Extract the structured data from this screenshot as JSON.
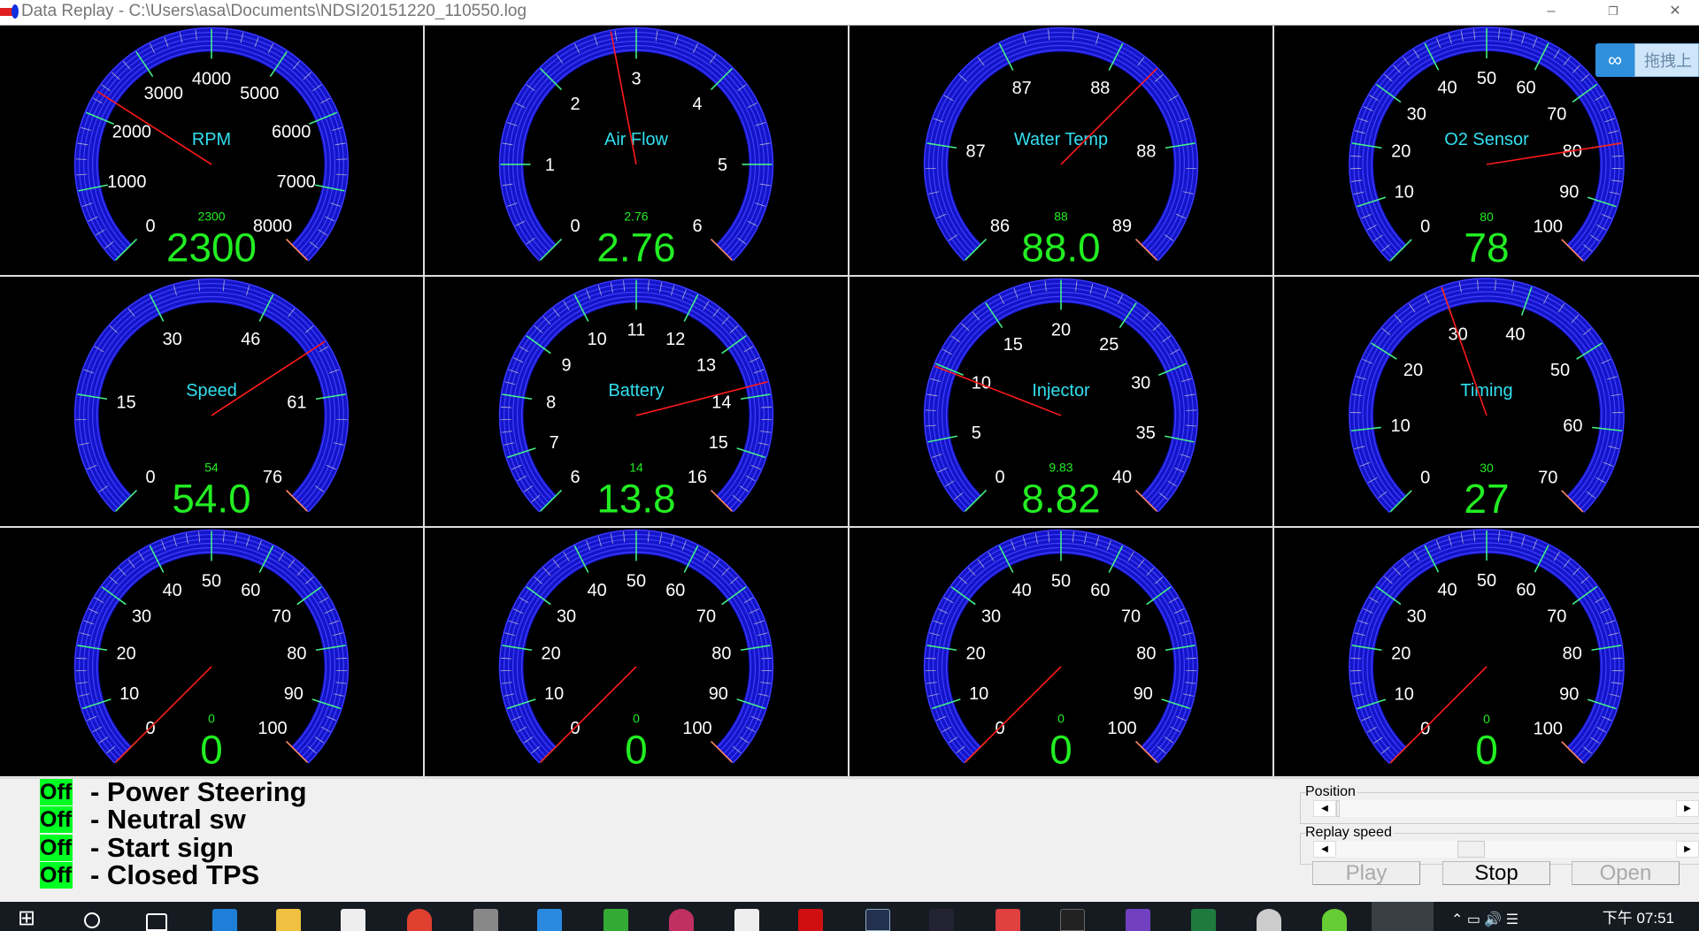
{
  "window": {
    "title": "Data Replay - C:\\Users\\asa\\Documents\\NDSI20151220_110550.log",
    "minimize": "–",
    "restore": "❐",
    "close": "✕"
  },
  "cloud_widget": {
    "icon": "cloud-link-icon",
    "label": "拖拽上"
  },
  "colors": {
    "arc": "#1414c8",
    "arc_line": "#4040ff",
    "label": "#ffffff",
    "title": "#33e0f0",
    "value": "#22ee22",
    "needle": "#ff1a1a",
    "major_tick": "#44ee88",
    "end_tick": "#ff8866"
  },
  "gauges": [
    {
      "name": "rpm",
      "title": "RPM",
      "min": 0,
      "max": 8000,
      "labels": [
        "0",
        "1000",
        "2000",
        "3000",
        "4000",
        "5000",
        "6000",
        "7000",
        "8000"
      ],
      "small": "2300",
      "value": "2300",
      "needle": 2300
    },
    {
      "name": "air-flow",
      "title": "Air Flow",
      "min": 0,
      "max": 6,
      "labels": [
        "0",
        "1",
        "2",
        "3",
        "4",
        "5",
        "6"
      ],
      "small": "2.76",
      "value": "2.76",
      "needle": 2.76
    },
    {
      "name": "water-temp",
      "title": "Water Temp",
      "min": 86,
      "max": 89,
      "labels": [
        "86",
        "87",
        "87",
        "88",
        "88",
        "89"
      ],
      "small": "88",
      "value": "88.0",
      "needle": 88
    },
    {
      "name": "o2-sensor",
      "title": "O2 Sensor",
      "min": 0,
      "max": 100,
      "labels": [
        "0",
        "10",
        "20",
        "30",
        "40",
        "50",
        "60",
        "70",
        "80",
        "90",
        "100"
      ],
      "small": "80",
      "value": "78",
      "needle": 80
    },
    {
      "name": "speed",
      "title": "Speed",
      "min": 0,
      "max": 76,
      "labels": [
        "0",
        "15",
        "30",
        "46",
        "61",
        "76"
      ],
      "small": "54",
      "value": "54.0",
      "needle": 54
    },
    {
      "name": "battery",
      "title": "Battery",
      "min": 6,
      "max": 16,
      "labels": [
        "6",
        "7",
        "8",
        "9",
        "10",
        "11",
        "12",
        "13",
        "14",
        "15",
        "16"
      ],
      "small": "14",
      "value": "13.8",
      "needle": 13.8
    },
    {
      "name": "injector",
      "title": "Injector",
      "min": 0,
      "max": 40,
      "labels": [
        "0",
        "5",
        "10",
        "15",
        "20",
        "25",
        "30",
        "35",
        "40"
      ],
      "small": "9.83",
      "value": "8.82",
      "needle": 9.83
    },
    {
      "name": "timing",
      "title": "Timing",
      "min": 0,
      "max": 70,
      "labels": [
        "0",
        "10",
        "20",
        "30",
        "40",
        "50",
        "60",
        "70"
      ],
      "small": "30",
      "value": "27",
      "needle": 30
    },
    {
      "name": "aux-1",
      "title": "",
      "min": 0,
      "max": 100,
      "labels": [
        "0",
        "10",
        "20",
        "30",
        "40",
        "50",
        "60",
        "70",
        "80",
        "90",
        "100"
      ],
      "small": "0",
      "value": "0",
      "needle": 0
    },
    {
      "name": "aux-2",
      "title": "",
      "min": 0,
      "max": 100,
      "labels": [
        "0",
        "10",
        "20",
        "30",
        "40",
        "50",
        "60",
        "70",
        "80",
        "90",
        "100"
      ],
      "small": "0",
      "value": "0",
      "needle": 0
    },
    {
      "name": "aux-3",
      "title": "",
      "min": 0,
      "max": 100,
      "labels": [
        "0",
        "10",
        "20",
        "30",
        "40",
        "50",
        "60",
        "70",
        "80",
        "90",
        "100"
      ],
      "small": "0",
      "value": "0",
      "needle": 0
    },
    {
      "name": "aux-4",
      "title": "",
      "min": 0,
      "max": 100,
      "labels": [
        "0",
        "10",
        "20",
        "30",
        "40",
        "50",
        "60",
        "70",
        "80",
        "90",
        "100"
      ],
      "small": "0",
      "value": "0",
      "needle": 0
    }
  ],
  "status": [
    {
      "state": "Off",
      "label": "- Power Steering"
    },
    {
      "state": "Off",
      "label": "- Neutral sw"
    },
    {
      "state": "Off",
      "label": "- Start sign"
    },
    {
      "state": "Off",
      "label": "- Closed TPS"
    }
  ],
  "controls": {
    "position_label": "Position",
    "position_value": 0.0,
    "speed_label": "Replay speed",
    "speed_value": 0.2,
    "left_arrow": "◀",
    "right_arrow": "▶",
    "play": "Play",
    "stop": "Stop",
    "open": "Open"
  },
  "taskbar": {
    "clock": "下午 07:51",
    "start": "⊞"
  }
}
